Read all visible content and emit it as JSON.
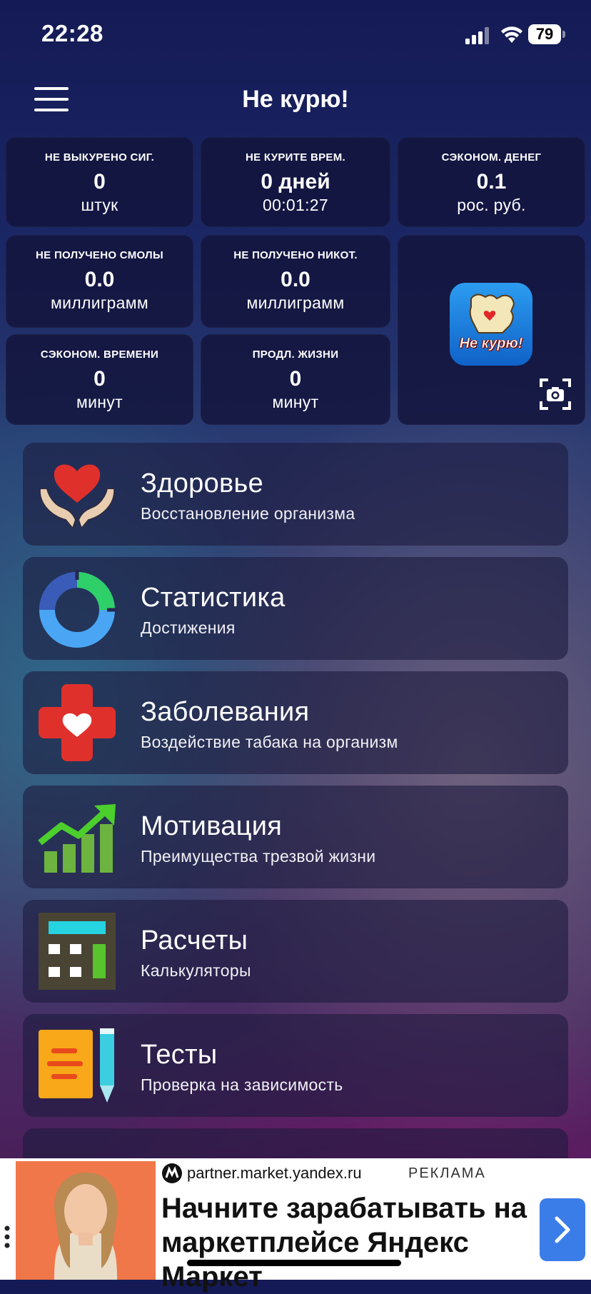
{
  "status_bar": {
    "time": "22:28",
    "battery": "79"
  },
  "header": {
    "title": "Не курю!"
  },
  "stats": [
    {
      "label": "НЕ ВЫКУРЕНО СИГ.",
      "value": "0",
      "unit": "штук"
    },
    {
      "label": "НЕ КУРИТЕ ВРЕМ.",
      "value": "0 дней",
      "unit": "00:01:27"
    },
    {
      "label": "СЭКОНОМ. ДЕНЕГ",
      "value": "0.1",
      "unit": "рос. руб."
    },
    {
      "label": "НЕ ПОЛУЧЕНО СМОЛЫ",
      "value": "0.0",
      "unit": "миллиграмм"
    },
    {
      "label": "НЕ ПОЛУЧЕНО НИКОТ.",
      "value": "0.0",
      "unit": "миллиграмм"
    },
    {
      "label": "СЭКОНОМ. ВРЕМЕНИ",
      "value": "0",
      "unit": "минут"
    },
    {
      "label": "ПРОДЛ. ЖИЗНИ",
      "value": "0",
      "unit": "минут"
    }
  ],
  "logo": {
    "text": "Не курю!"
  },
  "menu": [
    {
      "title": "Здоровье",
      "subtitle": "Восстановление организма",
      "icon": "heart-hands-icon"
    },
    {
      "title": "Статистика",
      "subtitle": "Достижения",
      "icon": "donut-chart-icon"
    },
    {
      "title": "Заболевания",
      "subtitle": "Воздействие табака на организм",
      "icon": "medical-cross-icon"
    },
    {
      "title": "Мотивация",
      "subtitle": "Преимущества трезвой жизни",
      "icon": "growth-chart-icon"
    },
    {
      "title": "Расчеты",
      "subtitle": "Калькуляторы",
      "icon": "calculator-icon"
    },
    {
      "title": "Тесты",
      "subtitle": "Проверка на зависимость",
      "icon": "notepad-pencil-icon"
    }
  ],
  "ad": {
    "source": "partner.market.yandex.ru",
    "tag": "РЕКЛАМА",
    "headline": "Начните зарабатывать на маркетплейсе Яндекс Маркет"
  },
  "colors": {
    "accent_red": "#e0302c",
    "accent_blue": "#3b7de8",
    "tile_bg": "#12143a"
  }
}
